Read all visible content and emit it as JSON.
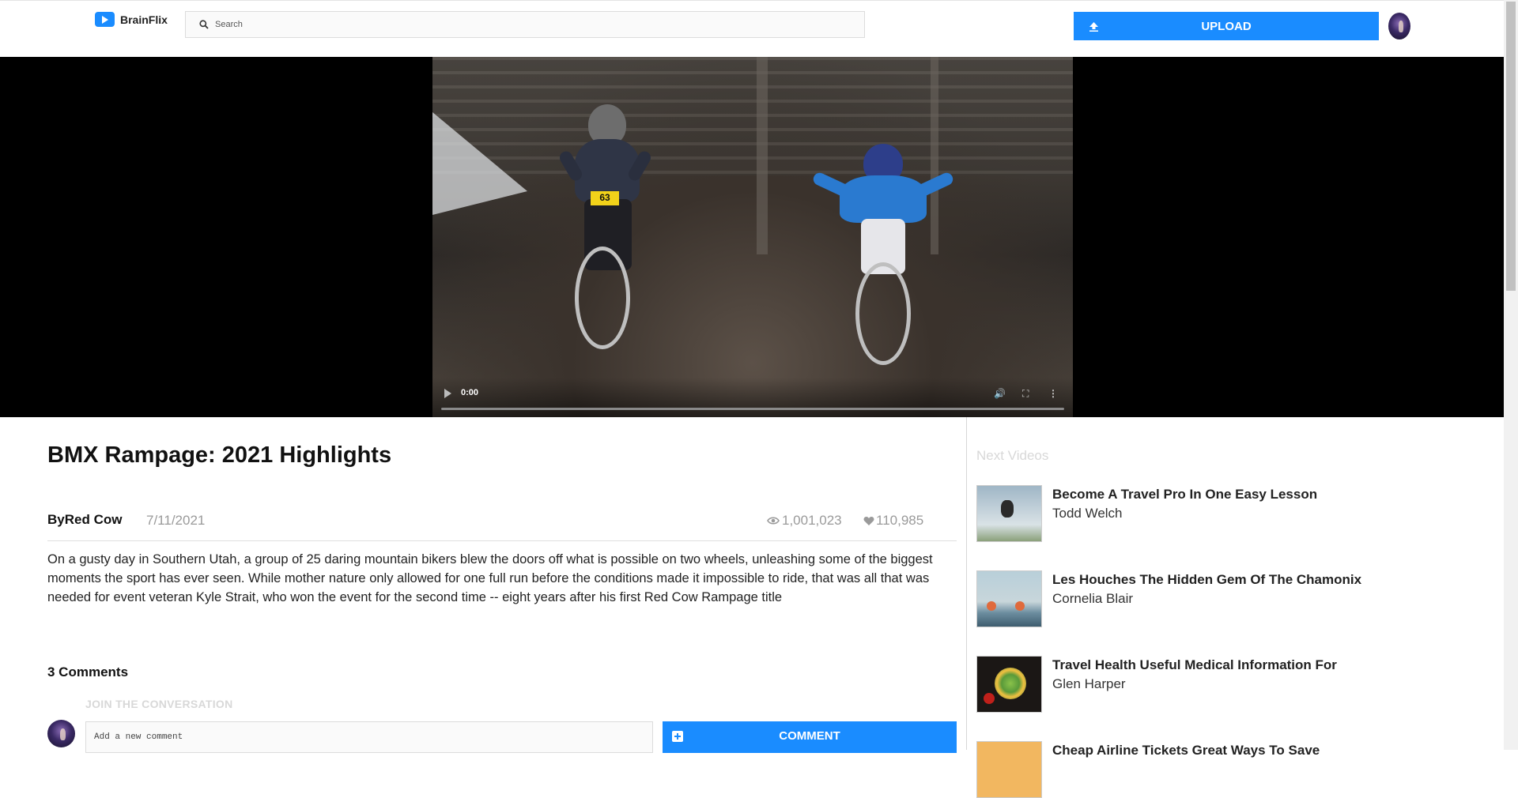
{
  "header": {
    "logo_text": "BrainFlix",
    "search_placeholder": "Search",
    "upload_label": "UPLOAD"
  },
  "video": {
    "current_time": "0:00"
  },
  "main": {
    "title": "BMX Rampage: 2021 Highlights",
    "by_prefix": "By",
    "channel": "Red Cow",
    "date": "7/11/2021",
    "views": "1,001,023",
    "likes": "110,985",
    "description": "On a gusty day in Southern Utah, a group of 25 daring mountain bikers blew the doors off what is possible on two wheels, unleashing some of the biggest moments the sport has ever seen. While mother nature only allowed for one full run before the conditions made it impossible to ride, that was all that was needed for event veteran Kyle Strait, who won the event for the second time -- eight years after his first Red Cow Rampage title",
    "plate_number": "63"
  },
  "comments": {
    "count_label": "3 Comments",
    "join_label": "JOIN THE CONVERSATION",
    "input_placeholder": "Add a new comment",
    "button_label": "COMMENT"
  },
  "sidebar": {
    "heading": "Next Videos",
    "items": [
      {
        "title": "Become A Travel Pro In One Easy Lesson",
        "author": "Todd Welch"
      },
      {
        "title": "Les Houches The Hidden Gem Of The Chamonix",
        "author": "Cornelia Blair"
      },
      {
        "title": "Travel Health Useful Medical Information For",
        "author": "Glen Harper"
      },
      {
        "title": "Cheap Airline Tickets Great Ways To Save",
        "author": ""
      }
    ]
  },
  "colors": {
    "accent": "#1a8cff",
    "muted_text": "#9a9a9a"
  },
  "icons": {
    "logo": "play-logo-icon",
    "search": "search-icon",
    "upload": "upload-icon",
    "views": "eye-icon",
    "likes": "heart-icon",
    "comment": "add-comment-icon"
  }
}
